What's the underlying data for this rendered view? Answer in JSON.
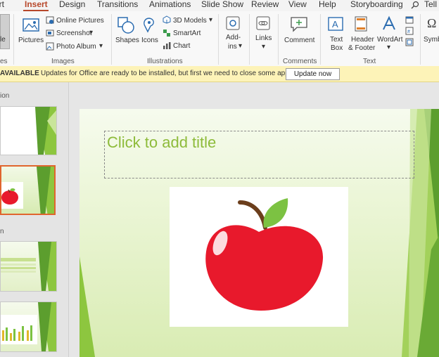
{
  "tabs": [
    {
      "label": "ert",
      "active": false
    },
    {
      "label": "Insert",
      "active": true
    },
    {
      "label": "Design",
      "active": false
    },
    {
      "label": "Transitions",
      "active": false
    },
    {
      "label": "Animations",
      "active": false
    },
    {
      "label": "Slide Show",
      "active": false
    },
    {
      "label": "Review",
      "active": false
    },
    {
      "label": "View",
      "active": false
    },
    {
      "label": "Help",
      "active": false
    },
    {
      "label": "Storyboarding",
      "active": false
    },
    {
      "label": "Tell",
      "active": false
    }
  ],
  "ribbon": {
    "images": {
      "partial_label": "le",
      "pictures": "Pictures",
      "online_pictures": "Online Pictures",
      "screenshot": "Screenshot",
      "photo_album": "Photo Album",
      "group": "Images",
      "left_group_partial": "es"
    },
    "illustrations": {
      "shapes": "Shapes",
      "icons": "Icons",
      "models": "3D Models",
      "smartart": "SmartArt",
      "chart": "Chart",
      "group": "Illustrations"
    },
    "addins": {
      "line1": "Add-",
      "line2": "ins"
    },
    "links": {
      "label": "Links"
    },
    "comments": {
      "comment": "Comment",
      "group": "Comments"
    },
    "text": {
      "textbox_1": "Text",
      "textbox_2": "Box",
      "header_1": "Header",
      "header_2": "& Footer",
      "wordart": "WordArt",
      "group": "Text"
    },
    "symbols": {
      "label": "Symb"
    }
  },
  "notification": {
    "title": "AVAILABLE",
    "message": "Updates for Office are ready to be installed, but first we need to close some apps.",
    "button": "Update now"
  },
  "left_panel": {
    "section_1": "ion",
    "section_2": "n"
  },
  "slide": {
    "title_placeholder": "Click to add title"
  },
  "colors": {
    "accent": "#b7472a",
    "title_green": "#8dbb3a",
    "apple_red": "#e8192c",
    "leaf_green": "#7cc242",
    "notification_bg": "#fdf3b8"
  }
}
